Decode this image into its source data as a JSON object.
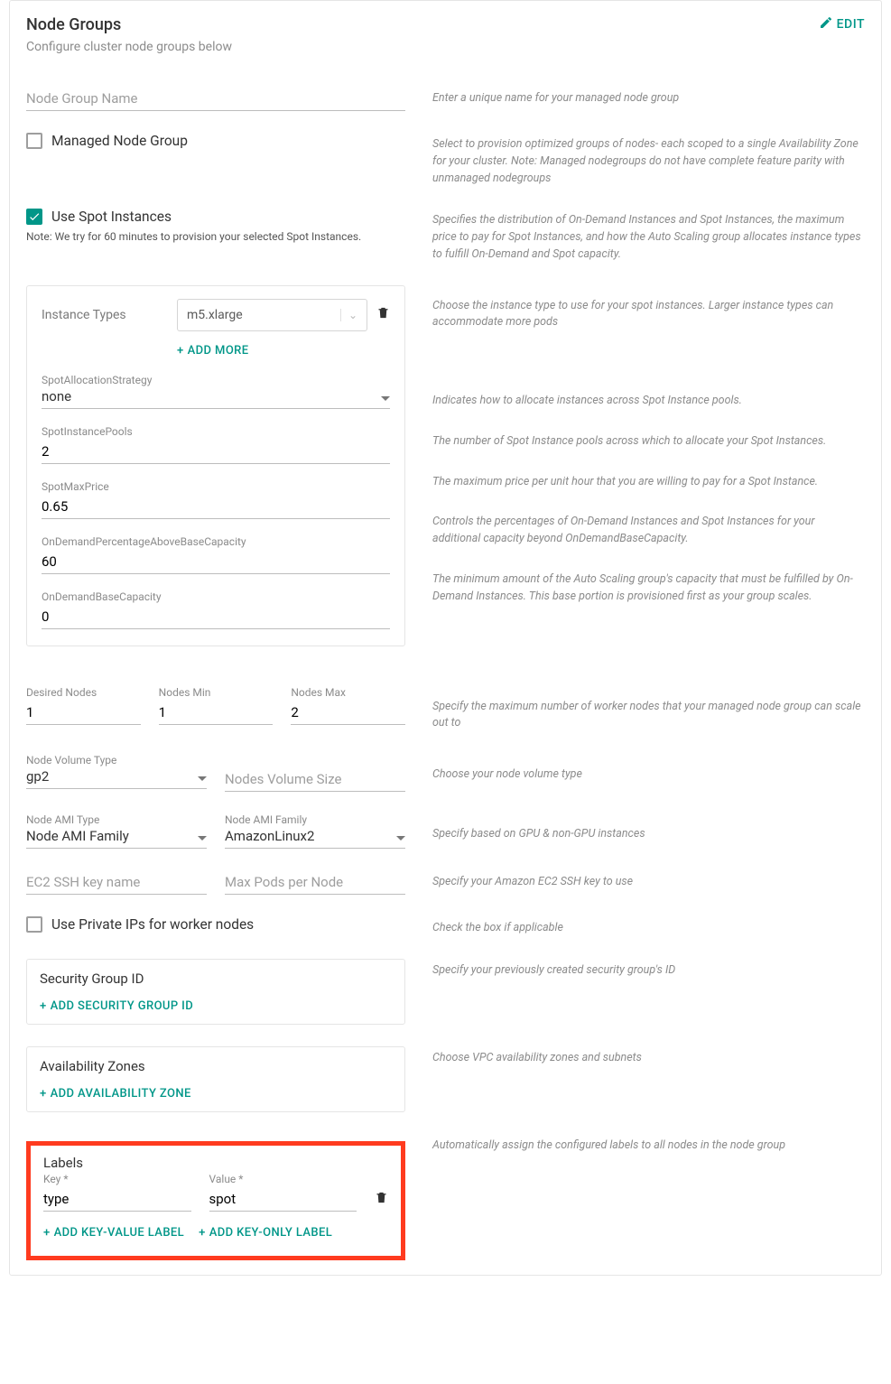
{
  "header": {
    "title": "Node Groups",
    "subtitle": "Configure cluster node groups below",
    "edit": "EDIT"
  },
  "nodeGroupName": {
    "placeholder": "Node Group Name",
    "help": "Enter a unique name for your managed node group"
  },
  "managed": {
    "label": "Managed Node Group",
    "help": "Select to provision optimized groups of nodes- each scoped to a single Availability Zone for your cluster. Note: Managed nodegroups do not have complete feature parity with unmanaged nodegroups"
  },
  "spot": {
    "label": "Use Spot Instances",
    "note": "Note: We try for 60 minutes to provision your selected Spot Instances.",
    "help": "Specifies the distribution of On-Demand Instances and Spot Instances, the maximum price to pay for Spot Instances, and how the Auto Scaling group allocates instance types to fulfill On-Demand and Spot capacity."
  },
  "instanceTypes": {
    "label": "Instance Types",
    "value": "m5.xlarge",
    "addMore": "ADD MORE",
    "help": "Choose the instance type to use for your spot instances. Larger instance types can accommodate more pods"
  },
  "spotStrategy": {
    "label": "SpotAllocationStrategy",
    "value": "none",
    "help": "Indicates how to allocate instances across Spot Instance pools."
  },
  "spotPools": {
    "label": "SpotInstancePools",
    "value": "2",
    "help": "The number of Spot Instance pools across which to allocate your Spot Instances."
  },
  "spotMaxPrice": {
    "label": "SpotMaxPrice",
    "value": "0.65",
    "help": "The maximum price per unit hour that you are willing to pay for a Spot Instance."
  },
  "onDemandPct": {
    "label": "OnDemandPercentageAboveBaseCapacity",
    "value": "60",
    "help": "Controls the percentages of On-Demand Instances and Spot Instances for your additional capacity beyond OnDemandBaseCapacity."
  },
  "onDemandBase": {
    "label": "OnDemandBaseCapacity",
    "value": "0",
    "help": "The minimum amount of the Auto Scaling group's capacity that must be fulfilled by On-Demand Instances. This base portion is provisioned first as your group scales."
  },
  "desired": {
    "label": "Desired Nodes",
    "value": "1"
  },
  "nodesMin": {
    "label": "Nodes Min",
    "value": "1"
  },
  "nodesMax": {
    "label": "Nodes Max",
    "value": "2",
    "help": "Specify the maximum number of worker nodes that your managed node group can scale out to"
  },
  "volType": {
    "label": "Node Volume Type",
    "value": "gp2",
    "help": "Choose your node volume type"
  },
  "volSize": {
    "placeholder": "Nodes Volume Size"
  },
  "amiType": {
    "label": "Node AMI Type",
    "value": "Node AMI Family"
  },
  "amiFamily": {
    "label": "Node AMI Family",
    "value": "AmazonLinux2",
    "help": "Specify based on GPU & non-GPU instances"
  },
  "sshKey": {
    "placeholder": "EC2 SSH key name",
    "help": "Specify your Amazon EC2 SSH key to use"
  },
  "maxPods": {
    "placeholder": "Max Pods per Node"
  },
  "privateIP": {
    "label": "Use Private IPs for worker nodes",
    "help": "Check the box if applicable"
  },
  "sg": {
    "title": "Security Group ID",
    "add": "ADD  SECURITY GROUP ID",
    "help": "Specify your previously created security group's ID"
  },
  "az": {
    "title": "Availability Zones",
    "add": "ADD  AVAILABILITY ZONE",
    "help": "Choose VPC availability zones and subnets"
  },
  "labels": {
    "title": "Labels",
    "keyLabel": "Key *",
    "valueLabel": "Value *",
    "keyValue": "type",
    "valValue": "spot",
    "addKV": "ADD KEY-VALUE LABEL",
    "addK": "ADD KEY-ONLY LABEL",
    "help": "Automatically assign the configured labels to all nodes in the node group"
  },
  "plus": "+"
}
